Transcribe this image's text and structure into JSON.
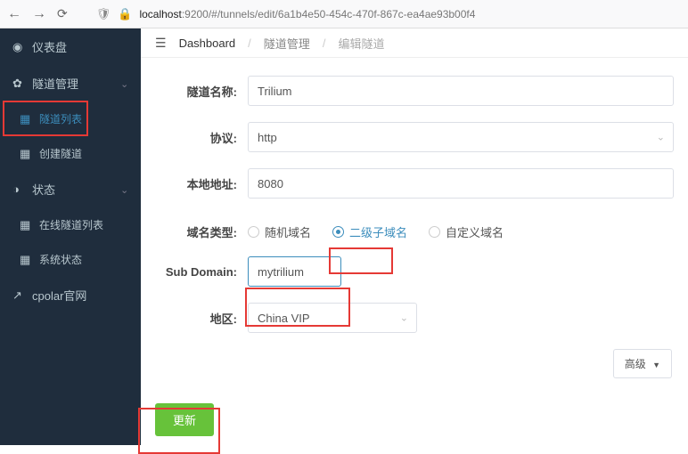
{
  "browser": {
    "url_prefix": "localhost",
    "url_rest": ":9200/#/tunnels/edit/6a1b4e50-454c-470f-867c-ea4ae93b00f4"
  },
  "sidebar": {
    "dashboard": "仪表盘",
    "tunnel_mgmt": "隧道管理",
    "tunnel_list": "隧道列表",
    "tunnel_create": "创建隧道",
    "status": "状态",
    "online_list": "在线隧道列表",
    "sys_status": "系统状态",
    "cpolar": "cpolar官网"
  },
  "breadcrumb": {
    "dash": "Dashboard",
    "mgmt": "隧道管理",
    "edit": "编辑隧道"
  },
  "form": {
    "name_label": "隧道名称:",
    "name_value": "Trilium",
    "proto_label": "协议:",
    "proto_value": "http",
    "addr_label": "本地地址:",
    "addr_value": "8080",
    "domain_type_label": "域名类型:",
    "radio_random": "随机域名",
    "radio_sub": "二级子域名",
    "radio_custom": "自定义域名",
    "subdomain_label": "Sub Domain:",
    "subdomain_value": "mytrilium",
    "region_label": "地区:",
    "region_value": "China VIP",
    "advanced": "高级",
    "update": "更新"
  }
}
